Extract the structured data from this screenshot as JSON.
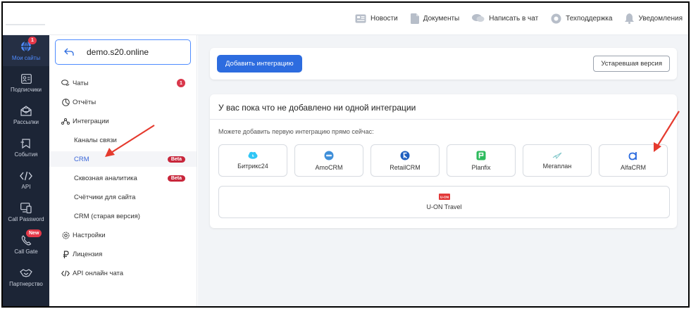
{
  "topnav": [
    {
      "label": "Новости",
      "icon": "news-icon"
    },
    {
      "label": "Документы",
      "icon": "document-icon"
    },
    {
      "label": "Написать в чат",
      "icon": "chat-icon"
    },
    {
      "label": "Техподдержка",
      "icon": "support-icon"
    },
    {
      "label": "Уведомления",
      "icon": "bell-icon"
    }
  ],
  "sidebar": {
    "items": [
      {
        "label": "Мои сайты",
        "icon": "globe-icon",
        "badge": "1"
      },
      {
        "label": "Подписчики",
        "icon": "contacts-icon"
      },
      {
        "label": "Рассылки",
        "icon": "mail-icon"
      },
      {
        "label": "События",
        "icon": "bookmark-icon"
      },
      {
        "label": "API",
        "icon": "code-icon"
      },
      {
        "label": "Call Password",
        "icon": "phone-screen-icon"
      },
      {
        "label": "Call Gate",
        "icon": "phone-icon",
        "badge": "New"
      },
      {
        "label": "Партнерство",
        "icon": "handshake-icon"
      }
    ]
  },
  "subnav": {
    "site": "demo.s20.online",
    "items": [
      {
        "label": "Чаты",
        "icon": "chats-icon",
        "count": "1"
      },
      {
        "label": "Отчёты",
        "icon": "reports-icon"
      },
      {
        "label": "Интеграции",
        "icon": "integrations-icon"
      },
      {
        "label": "Каналы связи"
      },
      {
        "label": "CRM",
        "badge": "Beta"
      },
      {
        "label": "Сквозная аналитика",
        "badge": "Beta"
      },
      {
        "label": "Счётчики для сайта"
      },
      {
        "label": "CRM (старая версия)"
      },
      {
        "label": "Настройки",
        "icon": "gear-icon"
      },
      {
        "label": "Лицензия",
        "icon": "ruble-icon"
      },
      {
        "label": "API онлайн чата",
        "icon": "code-icon"
      }
    ]
  },
  "main": {
    "add_button": "Добавить интеграцию",
    "old_version_button": "Устаревшая версия",
    "empty_title": "У вас пока что не добавлено ни одной интеграции",
    "empty_sub": "Можете добавить первую интеграцию прямо сейчас:",
    "integrations": [
      {
        "label": "Битрикс24",
        "icon": "bitrix24-icon",
        "color": "#2fc6f6"
      },
      {
        "label": "AmoCRM",
        "icon": "amocrm-icon",
        "color": "#3f8fd9"
      },
      {
        "label": "RetailCRM",
        "icon": "retailcrm-icon",
        "color": "#1f5fbf"
      },
      {
        "label": "Planfix",
        "icon": "planfix-icon",
        "color": "#2dbb5d"
      },
      {
        "label": "Мегаплан",
        "icon": "megaplan-icon",
        "color": "#7fc6c9"
      },
      {
        "label": "AlfaCRM",
        "icon": "alfacrm-icon",
        "color": "#2d6cdf"
      },
      {
        "label": "U-ON Travel",
        "icon": "uon-icon",
        "color": "#e23a3a",
        "logo_text": "U-ON"
      }
    ]
  },
  "colors": {
    "accent": "#2d6cdf",
    "sidebar_bg": "#1c2536",
    "arrow": "#e53a2e",
    "beta": "#c8263b"
  }
}
